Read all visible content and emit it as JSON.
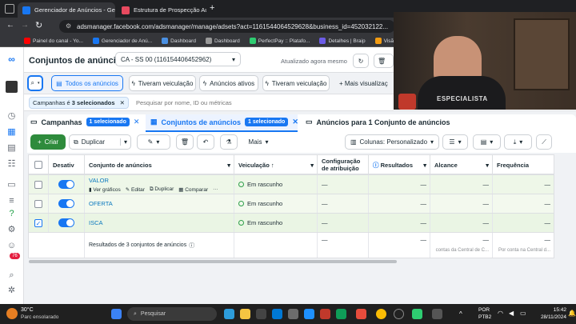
{
  "browser": {
    "tabs": [
      {
        "label": "Gerenciador de Anúncios - Ge",
        "active": true
      },
      {
        "label": "Estrutura de Prospecção Autom",
        "active": false
      }
    ],
    "new_tab": "+",
    "url": "adsmanager.facebook.com/adsmanager/manage/adsets?act=1161544064529628&business_id=452032122...",
    "bookmarks": [
      "Painel do canal - Yo...",
      "Gerenciador de Anú...",
      "Dashboard",
      "Dashboard",
      "PerfectPay :: Platafo...",
      "Detalhes | Braip",
      "Visão geral -"
    ]
  },
  "header": {
    "title": "Conjuntos de anúncios",
    "account": "CA - SS 00 (1161544064529628...)",
    "account_short": "CA - SS 00 (116154406452962)",
    "updated": "Atualizado agora mesmo"
  },
  "filters": {
    "all": "Todos os anúncios",
    "f1": "Tiveram veiculação",
    "f2": "Anúncios ativos",
    "f3": "Tiveram veiculação",
    "more": "+ Mais visualizaç",
    "chip": "Campanhas é 3 selecionados",
    "chip_prefix": "Campanhas é ",
    "chip_bold": "3 selecionados",
    "search_placeholder": "Pesquisar por nome, ID ou métricas"
  },
  "levels": {
    "campaigns": "Campanhas",
    "campaigns_badge": "1 selecionado",
    "adsets": "Conjuntos de anúncios",
    "adsets_badge": "1 selecionado",
    "ads": "Anúncios para 1 Conjunto de anúncios"
  },
  "actions": {
    "create": "Criar",
    "duplicate": "Duplicar",
    "more": "Mais",
    "columns": "Colunas: Personalizado"
  },
  "table": {
    "headers": [
      "Desativ",
      "Conjunto de anúncios",
      "Veiculação ↑",
      "Configuração de atribuição",
      "Resultados",
      "Alcance",
      "Frequência"
    ],
    "rows": [
      {
        "name": "VALOR",
        "status": "Em rascunho",
        "checked": false
      },
      {
        "name": "OFERTA",
        "status": "Em rascunho",
        "checked": false
      },
      {
        "name": "ISCA",
        "status": "Em rascunho",
        "checked": true
      }
    ],
    "row_actions": [
      "Ver gráficos",
      "Editar",
      "Duplicar",
      "Comparar",
      "···"
    ],
    "dash": "—",
    "footer": "Resultados de 3 conjuntos de anúncios",
    "footer_alcance": "contas da Central de C...",
    "footer_freq": "Por conta na Central d..."
  },
  "webcam": {
    "shirt_text": "ESPECIALISTA"
  },
  "badge_count": "76",
  "taskbar": {
    "weather_temp": "30°C",
    "weather_desc": "Parc ensolarado",
    "search": "Pesquisar",
    "lang": "POR",
    "layout": "PTB2",
    "time": "15:42",
    "date": "28/11/2024"
  },
  "colors": {
    "accent": "#1877f2",
    "create": "#2e8b3c",
    "row_selected": "#eaf5e4"
  }
}
